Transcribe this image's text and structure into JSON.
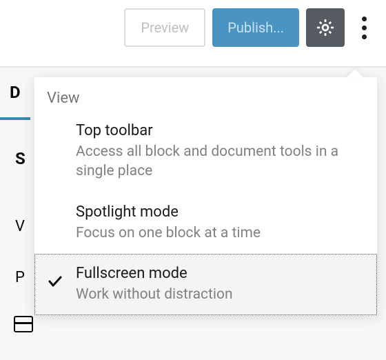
{
  "toolbar": {
    "preview_label": "Preview",
    "publish_label": "Publish...",
    "settings_icon": "gear-icon",
    "more_icon": "more-vertical-icon"
  },
  "background": {
    "tab_letter": "D",
    "letters": {
      "s": "S",
      "v": "V",
      "p": "P"
    }
  },
  "menu": {
    "section_title": "View",
    "items": [
      {
        "title": "Top toolbar",
        "desc": "Access all block and document tools in a single place",
        "selected": false
      },
      {
        "title": "Spotlight mode",
        "desc": "Focus on one block at a time",
        "selected": false
      },
      {
        "title": "Fullscreen mode",
        "desc": "Work without distraction",
        "selected": true
      }
    ]
  }
}
